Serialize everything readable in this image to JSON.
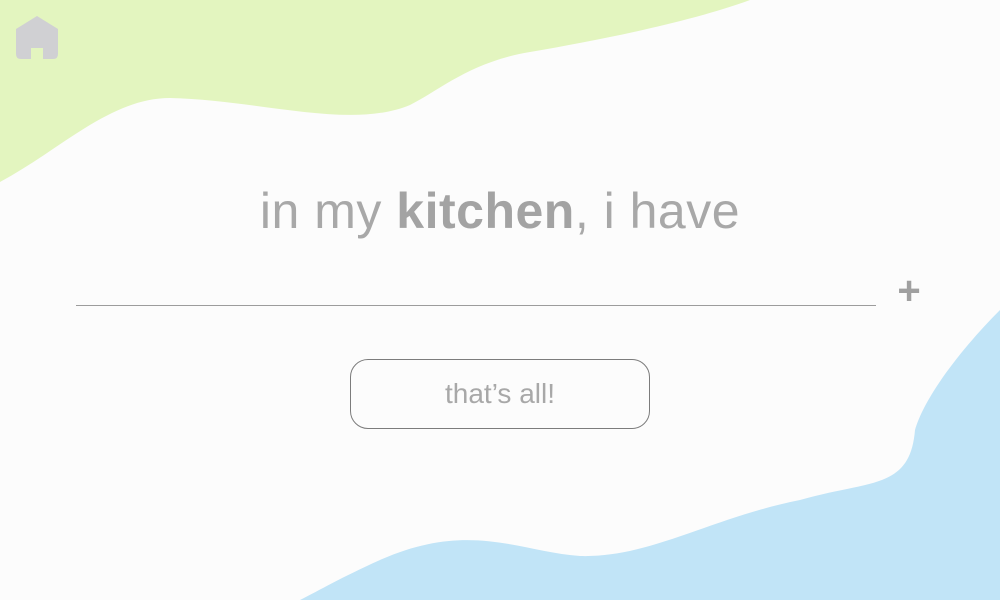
{
  "colors": {
    "background": "#fcfcfc",
    "blob_green": "#e3f5bf",
    "blob_blue": "#c1e4f7",
    "text_gray": "#a8a8a8",
    "icon_gray": "#d0d0d3"
  },
  "nav": {
    "home_icon": "home-icon"
  },
  "heading": {
    "prefix": "in my ",
    "emphasis": "kitchen",
    "suffix": ", i have"
  },
  "ingredient_input": {
    "value": "",
    "placeholder": ""
  },
  "add_button": {
    "label": "+"
  },
  "done_button": {
    "label": "that’s all!"
  }
}
